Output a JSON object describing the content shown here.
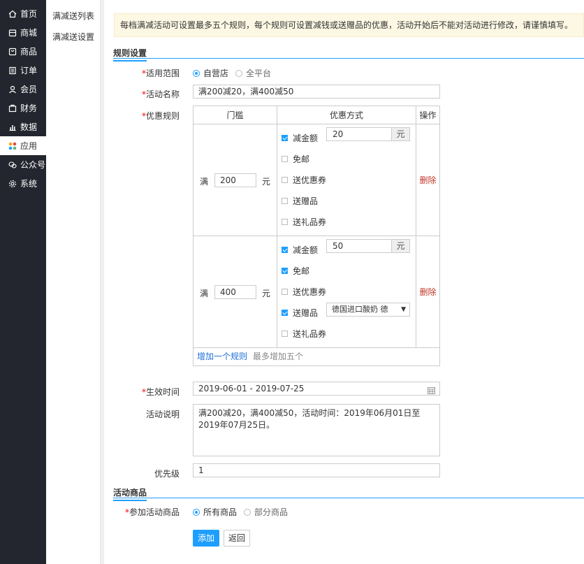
{
  "nav": {
    "items": [
      {
        "label": "首页",
        "icon": "home-icon"
      },
      {
        "label": "商城",
        "icon": "store-icon"
      },
      {
        "label": "商品",
        "icon": "goods-icon"
      },
      {
        "label": "订单",
        "icon": "order-icon"
      },
      {
        "label": "会员",
        "icon": "user-icon"
      },
      {
        "label": "财务",
        "icon": "finance-icon"
      },
      {
        "label": "数据",
        "icon": "chart-icon"
      },
      {
        "label": "应用",
        "icon": "apps-icon",
        "active": true
      },
      {
        "label": "公众号",
        "icon": "wechat-icon"
      },
      {
        "label": "系统",
        "icon": "settings-icon"
      }
    ]
  },
  "subnav": {
    "items": [
      "满减送列表",
      "满减送设置"
    ]
  },
  "notice": "每档满减活动可设置最多五个规则，每个规则可设置减钱或送赠品的优惠，活动开始后不能对活动进行修改，请谨慎填写。",
  "rule_section": "规则设置",
  "form": {
    "scope_label": "适用范围",
    "scope_opt1": "自营店",
    "scope_opt2": "全平台",
    "name_label": "活动名称",
    "name_value": "满200减20，满400减50",
    "rules_label": "优惠规则",
    "col_threshold": "门槛",
    "col_method": "优惠方式",
    "col_op": "操作",
    "man": "满",
    "yuan": "元",
    "opt_reduce": "减金额",
    "opt_free_ship": "免邮",
    "opt_coupon": "送优惠券",
    "opt_gift": "送赠品",
    "opt_gift_card": "送礼品券",
    "delete": "删除",
    "rule1": {
      "threshold": "200",
      "reduce": "20"
    },
    "rule2": {
      "threshold": "400",
      "reduce": "50",
      "gift": "德国进口酸奶 德"
    },
    "add_rule": "增加一个规则",
    "add_hint": "最多增加五个",
    "date_label": "生效时间",
    "date_value": "2019-06-01 - 2019-07-25",
    "desc_label": "活动说明",
    "desc_value": "满200减20，满400减50，活动时间：2019年06月01日至2019年07月25日。",
    "priority_label": "优先级",
    "priority_value": "1"
  },
  "goods_section": "活动商品",
  "goods": {
    "label": "参加活动商品",
    "opt_all": "所有商品",
    "opt_part": "部分商品"
  },
  "buttons": {
    "submit": "添加",
    "back": "返回"
  },
  "colors": {
    "primary": "#1e9fff",
    "nav_bg": "#23262e",
    "required": "#ff0000",
    "delete": "#c0392b"
  }
}
